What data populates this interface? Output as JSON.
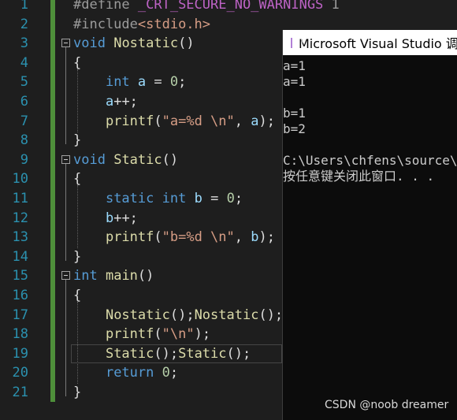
{
  "editor": {
    "line_numbers": [
      "1",
      "2",
      "3",
      "4",
      "5",
      "6",
      "7",
      "8",
      "9",
      "10",
      "11",
      "12",
      "13",
      "14",
      "15",
      "16",
      "17",
      "18",
      "19",
      "20",
      "21"
    ],
    "lines": [
      [
        {
          "t": "#define ",
          "c": "pp"
        },
        {
          "t": "_CRT_SECURE_NO_WARNINGS",
          "c": "mac"
        },
        {
          "t": " 1",
          "c": "pp"
        }
      ],
      [
        {
          "t": "#include",
          "c": "pp"
        },
        {
          "t": "<stdio.h>",
          "c": "str"
        }
      ],
      [
        {
          "t": "void",
          "c": "kw"
        },
        {
          "t": " ",
          "c": ""
        },
        {
          "t": "Nostatic",
          "c": "fn"
        },
        {
          "t": "()",
          "c": ""
        }
      ],
      [
        {
          "t": "{",
          "c": ""
        }
      ],
      [
        {
          "t": "    ",
          "c": ""
        },
        {
          "t": "int",
          "c": "kw"
        },
        {
          "t": " ",
          "c": ""
        },
        {
          "t": "a",
          "c": "var"
        },
        {
          "t": " = ",
          "c": ""
        },
        {
          "t": "0",
          "c": "num"
        },
        {
          "t": ";",
          "c": ""
        }
      ],
      [
        {
          "t": "    ",
          "c": ""
        },
        {
          "t": "a",
          "c": "var"
        },
        {
          "t": "++;",
          "c": ""
        }
      ],
      [
        {
          "t": "    ",
          "c": ""
        },
        {
          "t": "printf",
          "c": "fn"
        },
        {
          "t": "(",
          "c": ""
        },
        {
          "t": "\"a=%d \\n\"",
          "c": "str"
        },
        {
          "t": ", ",
          "c": ""
        },
        {
          "t": "a",
          "c": "var"
        },
        {
          "t": ");",
          "c": ""
        }
      ],
      [
        {
          "t": "}",
          "c": ""
        }
      ],
      [
        {
          "t": "void",
          "c": "kw"
        },
        {
          "t": " ",
          "c": ""
        },
        {
          "t": "Static",
          "c": "fn"
        },
        {
          "t": "()",
          "c": ""
        }
      ],
      [
        {
          "t": "{",
          "c": ""
        }
      ],
      [
        {
          "t": "    ",
          "c": ""
        },
        {
          "t": "static",
          "c": "kw"
        },
        {
          "t": " ",
          "c": ""
        },
        {
          "t": "int",
          "c": "kw"
        },
        {
          "t": " ",
          "c": ""
        },
        {
          "t": "b",
          "c": "var"
        },
        {
          "t": " = ",
          "c": ""
        },
        {
          "t": "0",
          "c": "num"
        },
        {
          "t": ";",
          "c": ""
        }
      ],
      [
        {
          "t": "    ",
          "c": ""
        },
        {
          "t": "b",
          "c": "var"
        },
        {
          "t": "++;",
          "c": ""
        }
      ],
      [
        {
          "t": "    ",
          "c": ""
        },
        {
          "t": "printf",
          "c": "fn"
        },
        {
          "t": "(",
          "c": ""
        },
        {
          "t": "\"b=%d \\n\"",
          "c": "str"
        },
        {
          "t": ", ",
          "c": ""
        },
        {
          "t": "b",
          "c": "var"
        },
        {
          "t": ");",
          "c": ""
        }
      ],
      [
        {
          "t": "}",
          "c": ""
        }
      ],
      [
        {
          "t": "int",
          "c": "kw"
        },
        {
          "t": " ",
          "c": ""
        },
        {
          "t": "main",
          "c": "fn"
        },
        {
          "t": "()",
          "c": ""
        }
      ],
      [
        {
          "t": "{",
          "c": ""
        }
      ],
      [
        {
          "t": "    ",
          "c": ""
        },
        {
          "t": "Nostatic",
          "c": "fn"
        },
        {
          "t": "();",
          "c": ""
        },
        {
          "t": "Nostatic",
          "c": "fn"
        },
        {
          "t": "();",
          "c": ""
        }
      ],
      [
        {
          "t": "    ",
          "c": ""
        },
        {
          "t": "printf",
          "c": "fn"
        },
        {
          "t": "(",
          "c": ""
        },
        {
          "t": "\"\\n\"",
          "c": "str"
        },
        {
          "t": ");",
          "c": ""
        }
      ],
      [
        {
          "t": "    ",
          "c": ""
        },
        {
          "t": "Static",
          "c": "fn"
        },
        {
          "t": "();",
          "c": ""
        },
        {
          "t": "Static",
          "c": "fn"
        },
        {
          "t": "();",
          "c": ""
        }
      ],
      [
        {
          "t": "    ",
          "c": ""
        },
        {
          "t": "return",
          "c": "kw"
        },
        {
          "t": " ",
          "c": ""
        },
        {
          "t": "0",
          "c": "num"
        },
        {
          "t": ";",
          "c": ""
        }
      ],
      [
        {
          "t": "}",
          "c": ""
        }
      ]
    ]
  },
  "console": {
    "title": "Microsoft Visual Studio 调",
    "output": [
      "a=1",
      "a=1",
      "",
      "b=1",
      "b=2",
      "",
      "C:\\Users\\chfens\\source\\",
      "按任意键关闭此窗口. . ."
    ]
  },
  "watermark": "CSDN @noob dreamer",
  "colors": {
    "background": "#1e1e1e",
    "keyword": "#569cd6",
    "function": "#dcdcaa",
    "string": "#d69d85",
    "number": "#b5cea8",
    "variable": "#9cdcfe",
    "line_number": "#2b91af",
    "change_bar": "#4e8f3a"
  }
}
